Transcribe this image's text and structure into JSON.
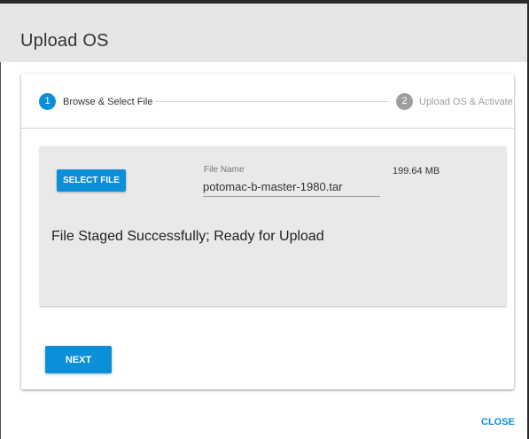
{
  "dialog": {
    "title": "Upload OS",
    "close_label": "CLOSE"
  },
  "stepper": {
    "steps": [
      {
        "number": "1",
        "label": "Browse & Select File",
        "active": true
      },
      {
        "number": "2",
        "label": "Upload OS & Activate",
        "active": false
      }
    ]
  },
  "file_panel": {
    "select_button_label": "SELECT FILE",
    "file_name_label": "File Name",
    "file_name_value": "potomac-b-master-1980.tar",
    "file_size": "199.64 MB",
    "status_message": "File Staged Successfully; Ready for Upload"
  },
  "actions": {
    "next_label": "NEXT"
  },
  "colors": {
    "accent": "#0b8fd8",
    "inactive_step": "#9e9e9e",
    "header_bg": "#e6e6e6",
    "panel_bg": "#e9e9e9"
  }
}
